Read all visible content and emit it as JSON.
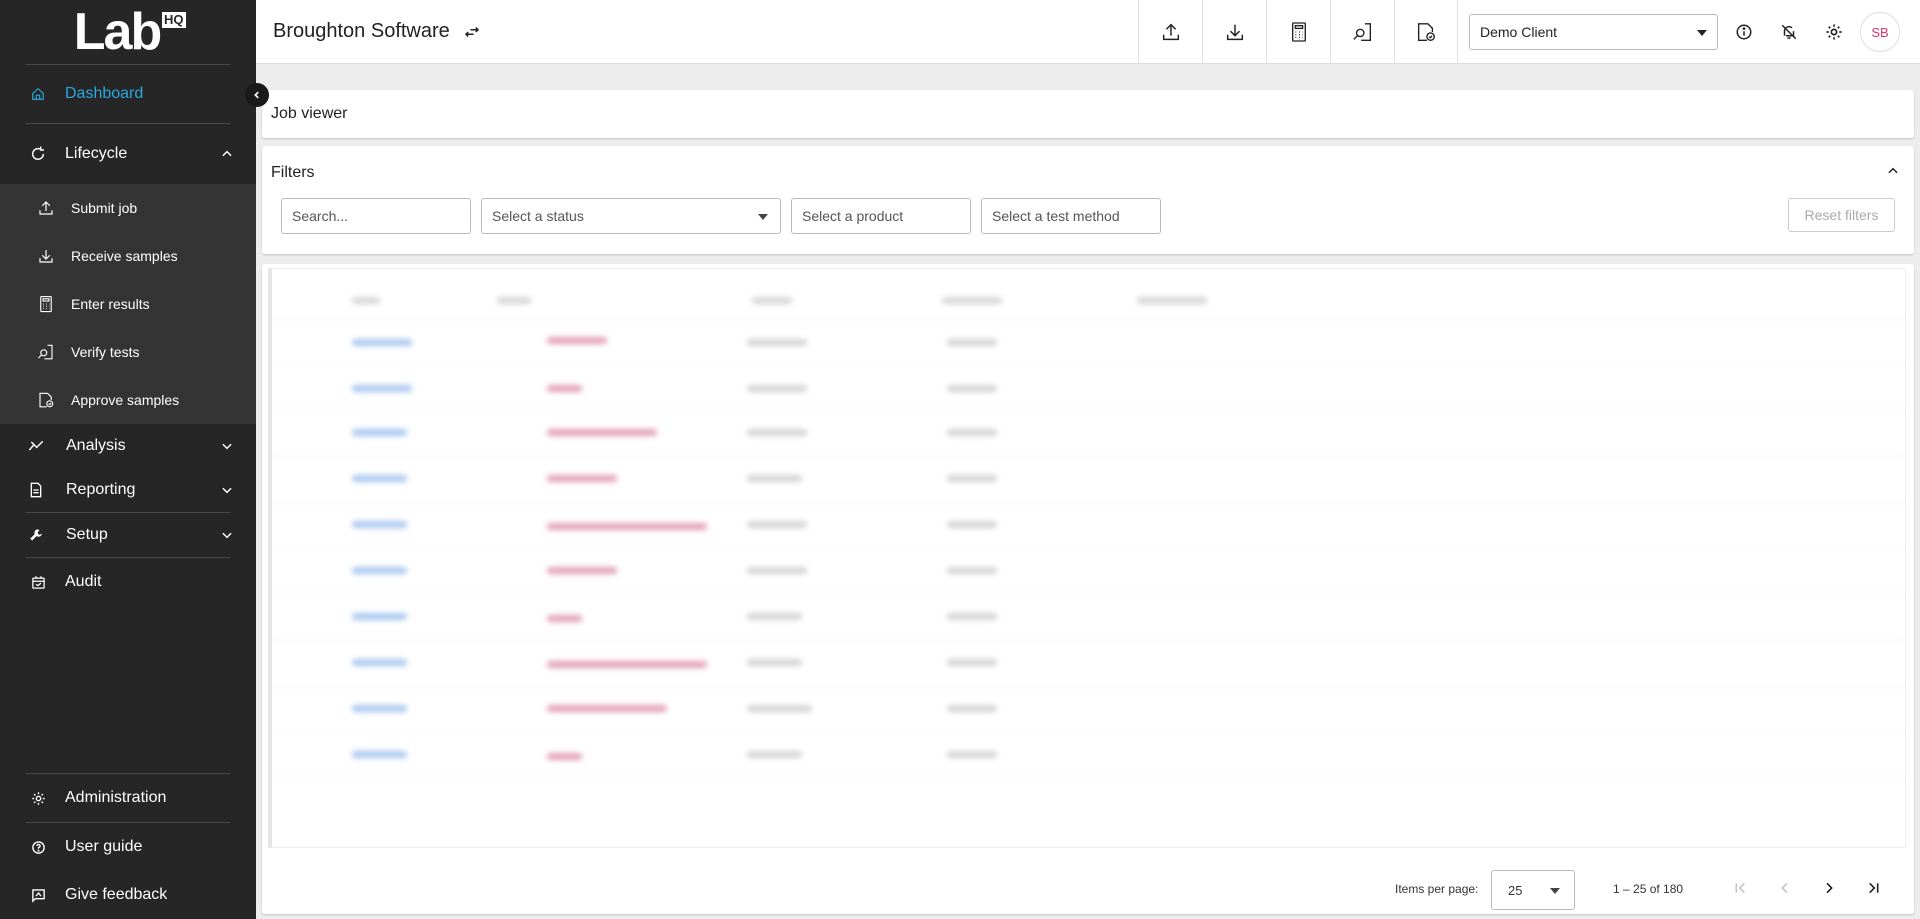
{
  "app": {
    "logo": "Lab",
    "logo_badge": "HQ"
  },
  "sidebar": {
    "dashboard": "Dashboard",
    "lifecycle": "Lifecycle",
    "lifecycle_items": [
      {
        "label": "Submit job",
        "icon": "upload-icon"
      },
      {
        "label": "Receive samples",
        "icon": "download-icon"
      },
      {
        "label": "Enter results",
        "icon": "calculator-icon"
      },
      {
        "label": "Verify tests",
        "icon": "verify-icon"
      },
      {
        "label": "Approve samples",
        "icon": "approve-icon"
      }
    ],
    "analysis": "Analysis",
    "reporting": "Reporting",
    "setup": "Setup",
    "audit": "Audit",
    "administration": "Administration",
    "user_guide": "User guide",
    "give_feedback": "Give feedback",
    "accent_color": "#29a8df"
  },
  "header": {
    "title": "Broughton Software",
    "client": "Demo Client",
    "avatar_initials": "SB",
    "avatar_color": "#d8396a"
  },
  "job_viewer": {
    "title": "Job viewer"
  },
  "filters": {
    "title": "Filters",
    "search_placeholder": "Search...",
    "status_placeholder": "Select a status",
    "product_placeholder": "Select a product",
    "test_method_placeholder": "Select a test method",
    "reset_label": "Reset filters"
  },
  "pagination": {
    "items_per_page_label": "Items per page:",
    "items_per_page": "25",
    "range": "1 – 25 of 180"
  }
}
